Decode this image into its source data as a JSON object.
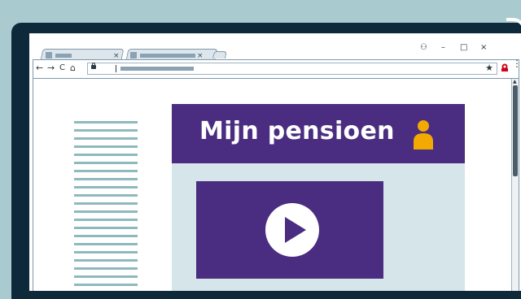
{
  "page": {
    "title": "Mijn pensioen"
  },
  "browser": {
    "tabs": [
      {
        "close": "×"
      },
      {
        "close": "×"
      }
    ],
    "window_controls": {
      "account": "⚇",
      "minimize": "–",
      "maximize": "□",
      "close": "×"
    },
    "nav": {
      "back": "←",
      "forward": "→",
      "reload": "C",
      "home": "⌂"
    },
    "bookmark_star": "★",
    "menu": "⋮",
    "scroll_up": "▲"
  },
  "colors": {
    "header_bg": "#4a2d80",
    "content_bg": "#d5e5ea",
    "accent_user": "#f2a900",
    "sidebar_lines": "#8fb9bd",
    "device_frame": "#0e2a3a",
    "background": "#a9cbd0"
  },
  "icons": {
    "user": "user-icon",
    "play": "play-icon",
    "lock": "lock-icon"
  }
}
